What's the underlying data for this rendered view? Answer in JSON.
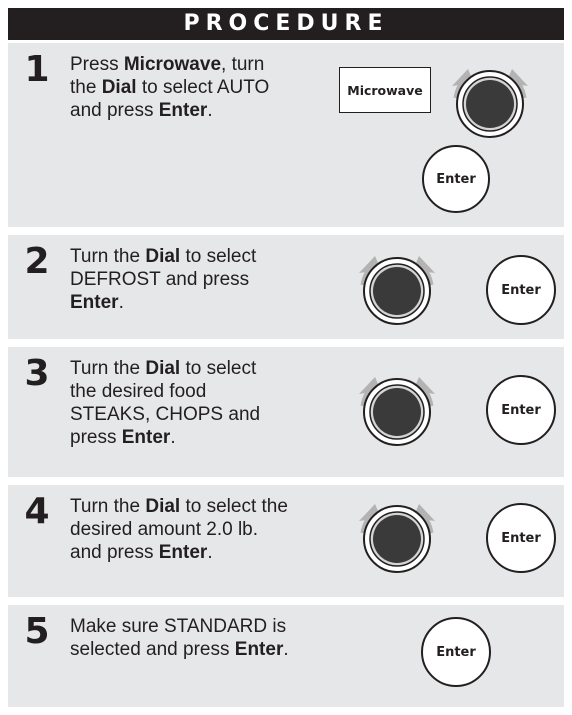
{
  "header": {
    "title": "PROCEDURE"
  },
  "steps": [
    {
      "number": "1",
      "parts": [
        "Press ",
        "Microwave",
        ", turn",
        "the ",
        "Dial",
        " to select AUTO",
        "and press ",
        "Enter",
        "."
      ]
    },
    {
      "number": "2",
      "parts": [
        "Turn the ",
        "Dial",
        " to select",
        "DEFROST and press",
        "Enter",
        "."
      ]
    },
    {
      "number": "3",
      "parts": [
        "Turn the ",
        "Dial",
        " to select",
        "the desired food",
        "STEAKS, CHOPS and",
        "press ",
        "Enter",
        "."
      ]
    },
    {
      "number": "4",
      "parts": [
        "Turn the ",
        "Dial",
        " to select the",
        "desired amount 2.0 lb.",
        "and press ",
        "Enter",
        "."
      ]
    },
    {
      "number": "5",
      "parts": [
        "Make sure STANDARD is",
        "selected and press ",
        "Enter",
        "."
      ]
    }
  ],
  "buttons": {
    "microwave_label": "Microwave",
    "enter_label": "Enter"
  },
  "icons": {
    "dial": "dial-knob-icon",
    "rotate_left": "rotate-left-arrow-icon",
    "rotate_right": "rotate-right-arrow-icon"
  },
  "colors": {
    "header_bg": "#231f20",
    "step_bg": "#e6e7e8",
    "dial_dark": "#3a3a3a",
    "arrow": "#b3b3b3"
  }
}
